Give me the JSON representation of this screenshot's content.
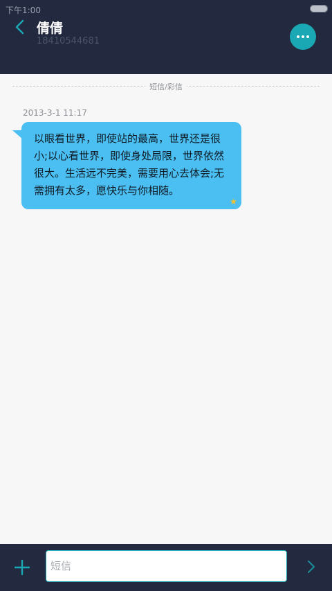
{
  "status_bar": {
    "time": "下午1:00",
    "battery_icon": "battery-icon"
  },
  "header": {
    "back_icon": "chevron-left-icon",
    "contact_name": "倩倩",
    "contact_number": "18410544681",
    "more_icon": "more-dots-icon"
  },
  "thread": {
    "divider_label": "短信/彩信",
    "messages": [
      {
        "time": "2013-3-1 11:17",
        "text": "以眼看世界，即使站的最高，世界还是很小;以心看世界，即使身处局限，世界依然很大。生活远不完美，需要用心去体会;无需拥有太多，愿快乐与你相随。",
        "starred": true
      }
    ]
  },
  "composer": {
    "add_icon": "plus-icon",
    "input_value": "",
    "input_placeholder": "短信",
    "send_icon": "chevron-right-icon"
  },
  "colors": {
    "header_bg": "#232a40",
    "accent": "#1aa9b4",
    "bubble": "#4cbff2",
    "star": "#f2c12e"
  }
}
